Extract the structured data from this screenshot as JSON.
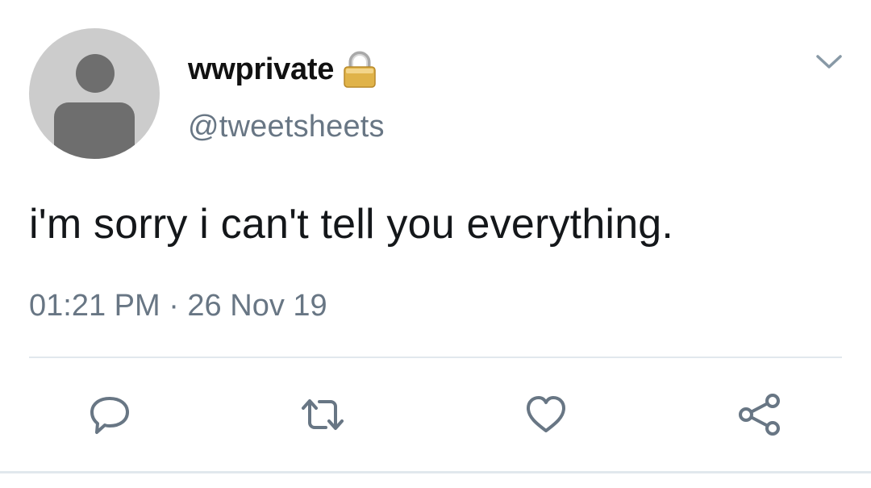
{
  "tweet": {
    "display_name": "wwprivate",
    "handle": "@tweetsheets",
    "text": "i'm sorry i can't tell you everything.",
    "timestamp": "01:21 PM · 26 Nov 19"
  },
  "icons": {
    "avatar": "default-avatar-silhouette",
    "lock": "lock-icon",
    "menu": "chevron-down-icon",
    "actions": [
      "reply-icon",
      "retweet-icon",
      "like-icon",
      "share-icon"
    ]
  },
  "colors": {
    "text_primary": "#14171a",
    "text_secondary": "#687684",
    "icon": "#687684",
    "avatar_bg": "#cccccc",
    "lock_gold": "#e0b349",
    "divider": "#e1e8ed"
  }
}
